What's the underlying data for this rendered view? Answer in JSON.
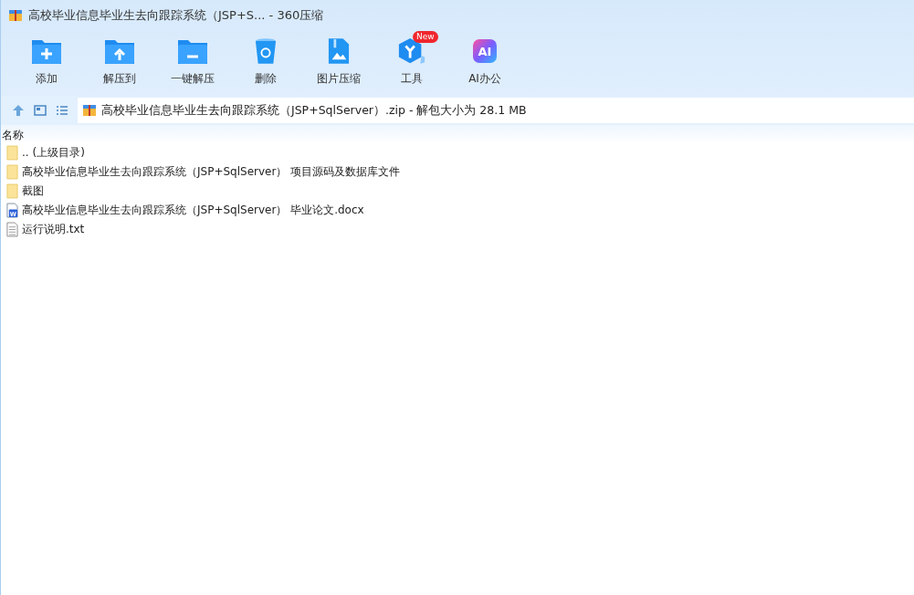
{
  "window": {
    "title": "高校毕业信息毕业生去向跟踪系统（JSP+S... - 360压缩"
  },
  "toolbar": [
    {
      "kind": "add",
      "label": "添加"
    },
    {
      "kind": "extract-to",
      "label": "解压到"
    },
    {
      "kind": "extract",
      "label": "一键解压"
    },
    {
      "kind": "delete",
      "label": "删除"
    },
    {
      "kind": "image",
      "label": "图片压缩"
    },
    {
      "kind": "tools",
      "label": "工具",
      "badge": "New"
    },
    {
      "kind": "ai",
      "label": "AI办公",
      "glyph": "AI"
    }
  ],
  "address": {
    "path": "高校毕业信息毕业生去向跟踪系统（JSP+SqlServer）.zip - 解包大小为 28.1 MB"
  },
  "table": {
    "columns": [
      "名称"
    ],
    "rows": [
      {
        "kind": "folder",
        "name": ".. (上级目录)"
      },
      {
        "kind": "folder",
        "name": "高校毕业信息毕业生去向跟踪系统（JSP+SqlServer） 项目源码及数据库文件"
      },
      {
        "kind": "folder",
        "name": "截图"
      },
      {
        "kind": "docx",
        "name": "高校毕业信息毕业生去向跟踪系统（JSP+SqlServer） 毕业论文.docx",
        "glyph": "W"
      },
      {
        "kind": "txt",
        "name": "运行说明.txt"
      }
    ]
  }
}
